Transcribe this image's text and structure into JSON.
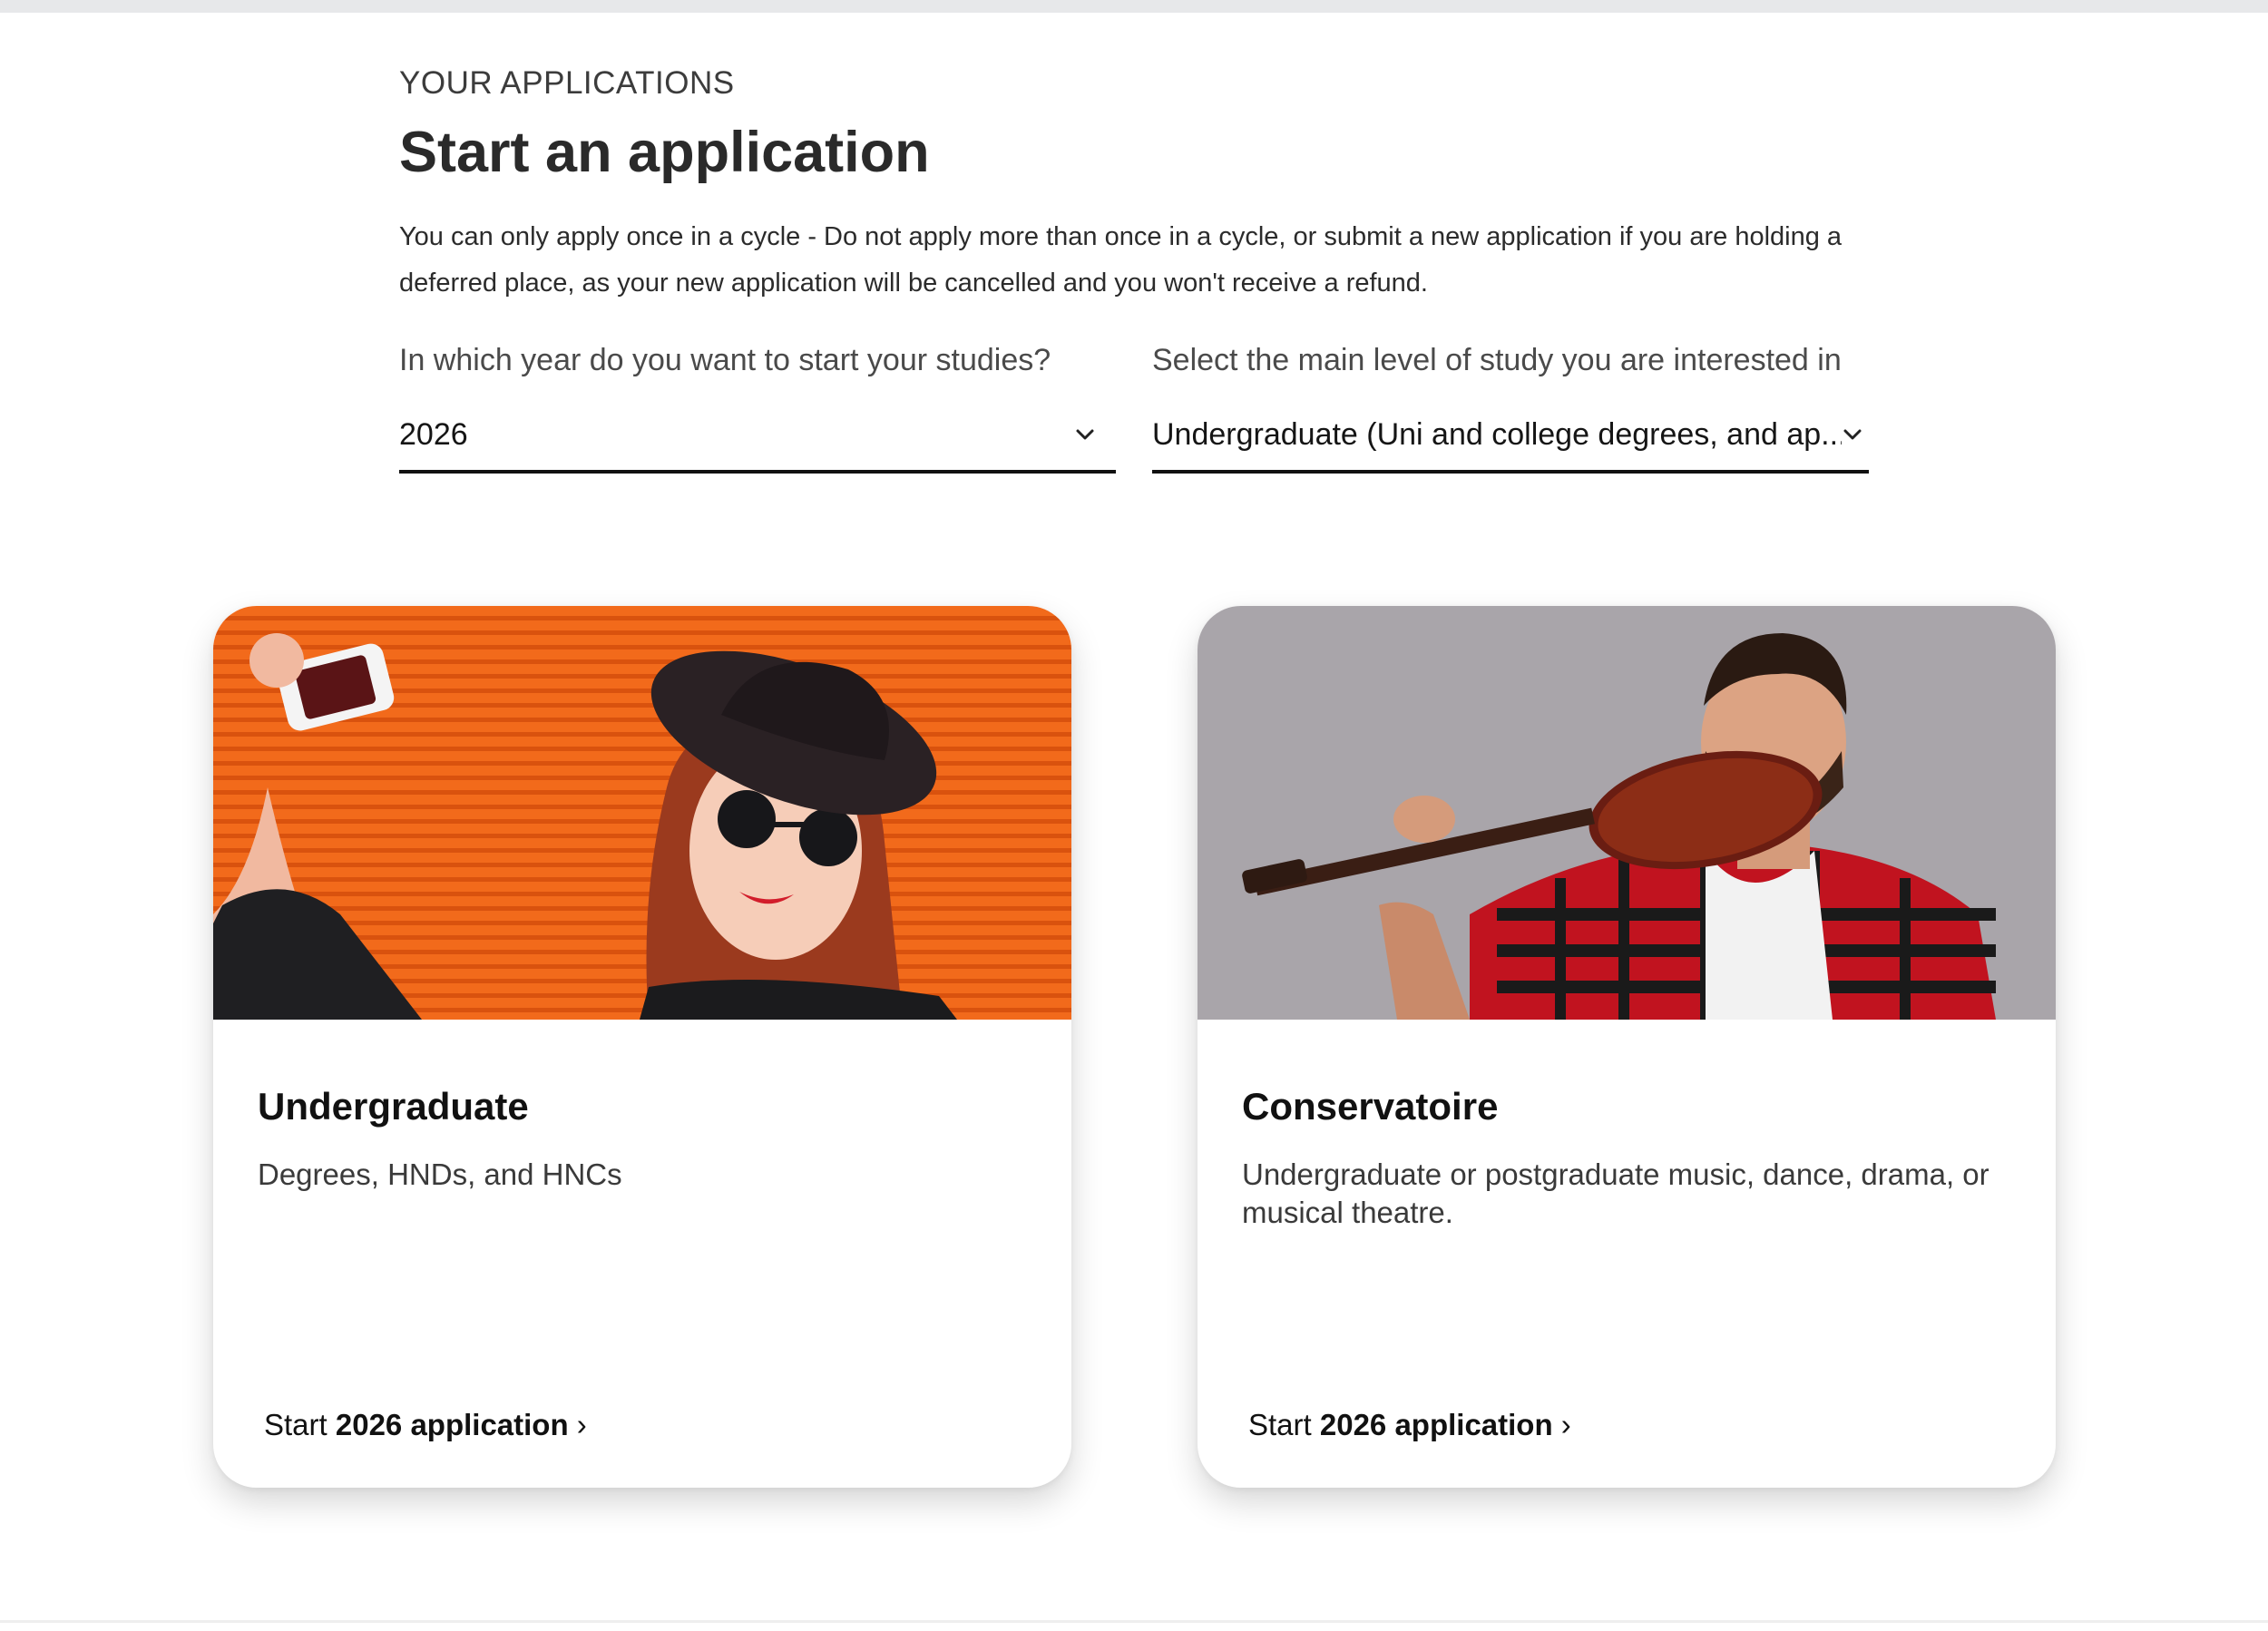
{
  "header": {
    "eyebrow": "YOUR APPLICATIONS",
    "title": "Start an application",
    "notice": "You can only apply once in a cycle - Do not apply more than once in a cycle, or submit a new application if you are holding a deferred place, as your new application will be cancelled and you won't receive a refund."
  },
  "filters": {
    "year": {
      "label": "In which year do you want to start your studies?",
      "value": "2026"
    },
    "level": {
      "label": "Select the main level of study you are interested in",
      "value": "Undergraduate (Uni and college degrees, and ap..."
    }
  },
  "cards": [
    {
      "title": "Undergraduate",
      "description": "Degrees, HNDs, and HNCs",
      "link_prefix": "Start ",
      "link_strong": "2026 application",
      "link_suffix": " ›",
      "image_icon": "selfie-photo",
      "accent": "#f26a1b"
    },
    {
      "title": "Conservatoire",
      "description": "Undergraduate or postgraduate music, dance, drama, or musical theatre.",
      "link_prefix": "Start ",
      "link_strong": "2026 application",
      "link_suffix": " ›",
      "image_icon": "guitarist-photo",
      "accent": "#a9a5aa"
    }
  ]
}
